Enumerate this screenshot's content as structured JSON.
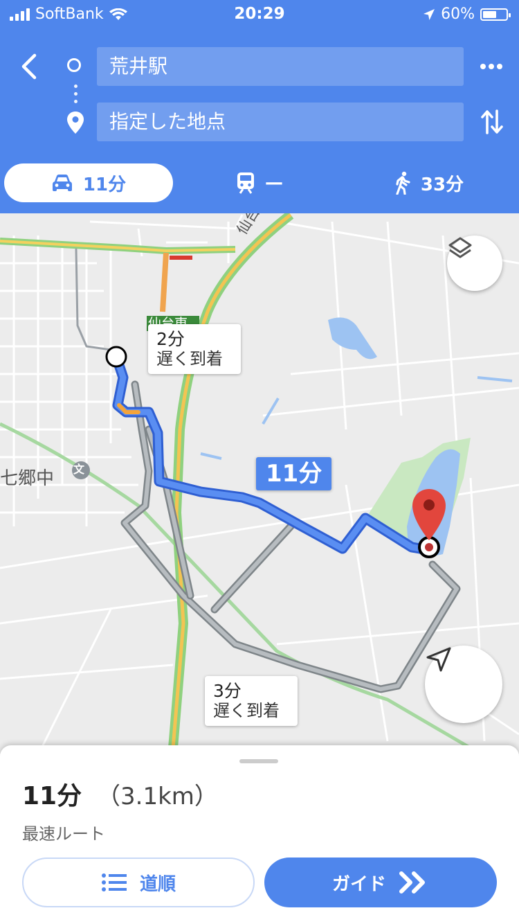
{
  "status_bar": {
    "carrier": "SoftBank",
    "time": "20:29",
    "battery": "60%",
    "battery_level": 0.6
  },
  "search": {
    "origin": "荒井駅",
    "destination": "指定した地点"
  },
  "modes": {
    "drive": "11分",
    "transit": "—",
    "walk": "33分"
  },
  "map": {
    "main_route_time": "11分",
    "alt1_time": "2分",
    "alt1_note": "遅く到着",
    "alt2_time": "3分",
    "alt2_note": "遅く到着",
    "place_school": "七郷中",
    "school_icon_glyph": "文",
    "road_label": "仙台東",
    "road_label2": "仙台東"
  },
  "summary": {
    "time": "11分",
    "distance": "（3.1km）",
    "route_desc": "最速ルート"
  },
  "buttons": {
    "steps": "道順",
    "guide": "ガイド"
  },
  "colors": {
    "accent": "#4f86ec",
    "route": "#4a7ff0",
    "alt_route": "#9aa0a6",
    "pin": "#d33a32"
  }
}
